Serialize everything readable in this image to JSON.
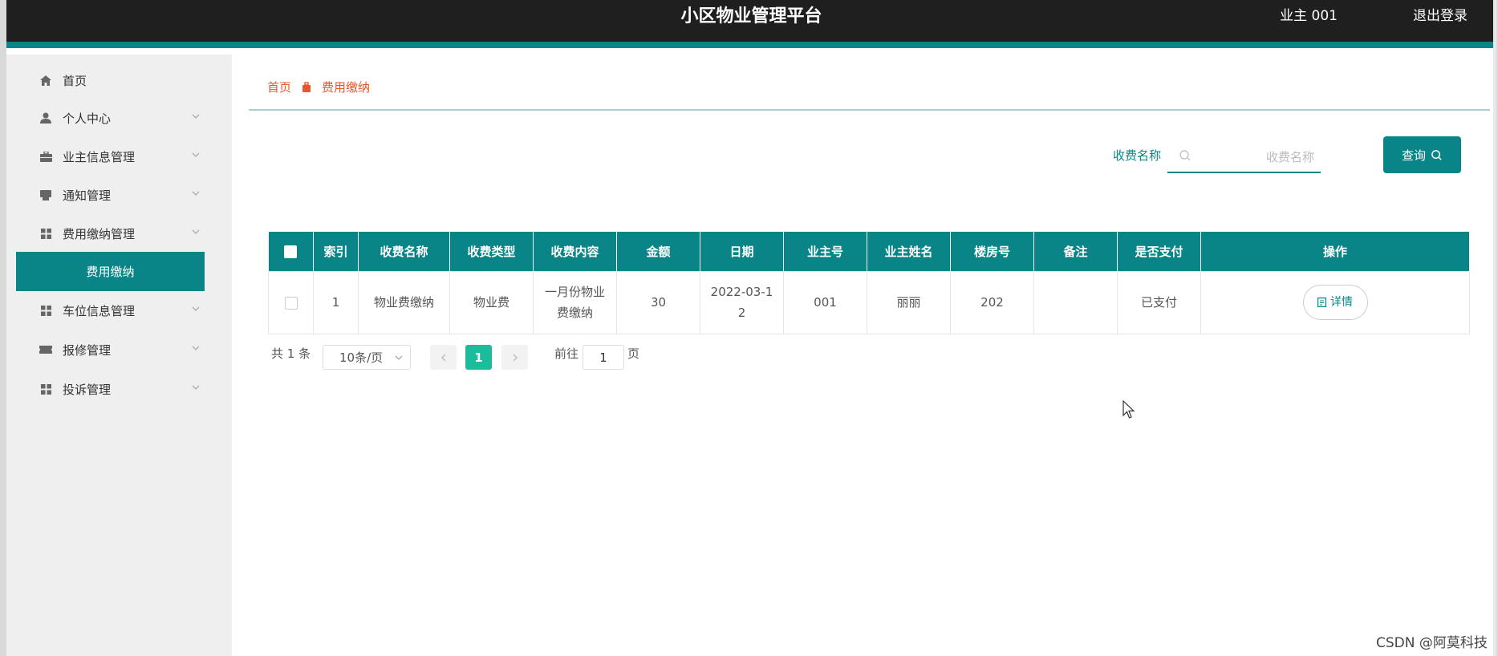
{
  "header": {
    "title": "小区物业管理平台",
    "user": "业主 001",
    "logout": "退出登录"
  },
  "sidebar": {
    "items": [
      {
        "label": "首页",
        "icon": "home-icon",
        "has_arrow": false
      },
      {
        "label": "个人中心",
        "icon": "user-icon",
        "has_arrow": true
      },
      {
        "label": "业主信息管理",
        "icon": "briefcase-icon",
        "has_arrow": true
      },
      {
        "label": "通知管理",
        "icon": "printer-icon",
        "has_arrow": true
      },
      {
        "label": "费用缴纳管理",
        "icon": "grid-icon",
        "has_arrow": true
      },
      {
        "label": "车位信息管理",
        "icon": "grid-icon",
        "has_arrow": true
      },
      {
        "label": "报修管理",
        "icon": "ticket-icon",
        "has_arrow": true
      },
      {
        "label": "投诉管理",
        "icon": "grid-icon",
        "has_arrow": true
      }
    ],
    "active_sub": "费用缴纳"
  },
  "breadcrumb": {
    "home": "首页",
    "current": "费用缴纳"
  },
  "search": {
    "label": "收费名称",
    "placeholder": "收费名称",
    "value": "",
    "button": "查询"
  },
  "table": {
    "columns": [
      "索引",
      "收费名称",
      "收费类型",
      "收费内容",
      "金额",
      "日期",
      "业主号",
      "业主姓名",
      "楼房号",
      "备注",
      "是否支付",
      "操作"
    ],
    "rows": [
      {
        "index": "1",
        "name": "物业费缴纳",
        "type": "物业费",
        "content_line1": "一月份物业",
        "content_line2": "费缴纳",
        "amount": "30",
        "date_line1": "2022-03-1",
        "date_line2": "2",
        "owner_no": "001",
        "owner_name": "丽丽",
        "room": "202",
        "remark": "",
        "paid": "已支付",
        "action": "详情"
      }
    ]
  },
  "pagination": {
    "total": "共 1 条",
    "page_size": "10条/页",
    "current": "1",
    "goto_label": "前往",
    "goto_value": "1",
    "page_suffix": "页"
  },
  "watermark": "CSDN @阿莫科技",
  "colors": {
    "accent": "#0a8587",
    "header_bg": "#1f1f1f",
    "breadcrumb": "#e4572e",
    "page_active": "#1abc9c"
  }
}
